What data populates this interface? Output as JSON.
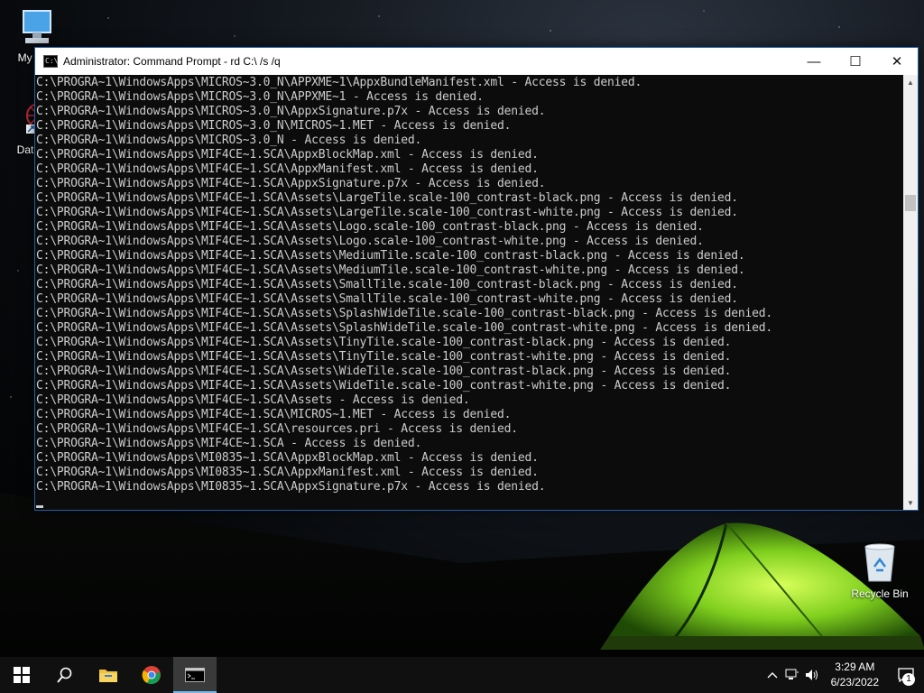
{
  "desktop": {
    "icons": [
      {
        "label": "My Co"
      },
      {
        "label": "DataW"
      },
      {
        "label": "Recycle Bin"
      }
    ]
  },
  "window": {
    "title": "Administrator: Command Prompt - rd  C:\\ /s /q",
    "controls": {
      "minimize": "—",
      "maximize": "☐",
      "close": "✕"
    },
    "lines": [
      "C:\\PROGRA~1\\WindowsApps\\MICROS~3.0_N\\APPXME~1\\AppxBundleManifest.xml - Access is denied.",
      "C:\\PROGRA~1\\WindowsApps\\MICROS~3.0_N\\APPXME~1 - Access is denied.",
      "C:\\PROGRA~1\\WindowsApps\\MICROS~3.0_N\\AppxSignature.p7x - Access is denied.",
      "C:\\PROGRA~1\\WindowsApps\\MICROS~3.0_N\\MICROS~1.MET - Access is denied.",
      "C:\\PROGRA~1\\WindowsApps\\MICROS~3.0_N - Access is denied.",
      "C:\\PROGRA~1\\WindowsApps\\MIF4CE~1.SCA\\AppxBlockMap.xml - Access is denied.",
      "C:\\PROGRA~1\\WindowsApps\\MIF4CE~1.SCA\\AppxManifest.xml - Access is denied.",
      "C:\\PROGRA~1\\WindowsApps\\MIF4CE~1.SCA\\AppxSignature.p7x - Access is denied.",
      "C:\\PROGRA~1\\WindowsApps\\MIF4CE~1.SCA\\Assets\\LargeTile.scale-100_contrast-black.png - Access is denied.",
      "C:\\PROGRA~1\\WindowsApps\\MIF4CE~1.SCA\\Assets\\LargeTile.scale-100_contrast-white.png - Access is denied.",
      "C:\\PROGRA~1\\WindowsApps\\MIF4CE~1.SCA\\Assets\\Logo.scale-100_contrast-black.png - Access is denied.",
      "C:\\PROGRA~1\\WindowsApps\\MIF4CE~1.SCA\\Assets\\Logo.scale-100_contrast-white.png - Access is denied.",
      "C:\\PROGRA~1\\WindowsApps\\MIF4CE~1.SCA\\Assets\\MediumTile.scale-100_contrast-black.png - Access is denied.",
      "C:\\PROGRA~1\\WindowsApps\\MIF4CE~1.SCA\\Assets\\MediumTile.scale-100_contrast-white.png - Access is denied.",
      "C:\\PROGRA~1\\WindowsApps\\MIF4CE~1.SCA\\Assets\\SmallTile.scale-100_contrast-black.png - Access is denied.",
      "C:\\PROGRA~1\\WindowsApps\\MIF4CE~1.SCA\\Assets\\SmallTile.scale-100_contrast-white.png - Access is denied.",
      "C:\\PROGRA~1\\WindowsApps\\MIF4CE~1.SCA\\Assets\\SplashWideTile.scale-100_contrast-black.png - Access is denied.",
      "C:\\PROGRA~1\\WindowsApps\\MIF4CE~1.SCA\\Assets\\SplashWideTile.scale-100_contrast-white.png - Access is denied.",
      "C:\\PROGRA~1\\WindowsApps\\MIF4CE~1.SCA\\Assets\\TinyTile.scale-100_contrast-black.png - Access is denied.",
      "C:\\PROGRA~1\\WindowsApps\\MIF4CE~1.SCA\\Assets\\TinyTile.scale-100_contrast-white.png - Access is denied.",
      "C:\\PROGRA~1\\WindowsApps\\MIF4CE~1.SCA\\Assets\\WideTile.scale-100_contrast-black.png - Access is denied.",
      "C:\\PROGRA~1\\WindowsApps\\MIF4CE~1.SCA\\Assets\\WideTile.scale-100_contrast-white.png - Access is denied.",
      "C:\\PROGRA~1\\WindowsApps\\MIF4CE~1.SCA\\Assets - Access is denied.",
      "C:\\PROGRA~1\\WindowsApps\\MIF4CE~1.SCA\\MICROS~1.MET - Access is denied.",
      "C:\\PROGRA~1\\WindowsApps\\MIF4CE~1.SCA\\resources.pri - Access is denied.",
      "C:\\PROGRA~1\\WindowsApps\\MIF4CE~1.SCA - Access is denied.",
      "C:\\PROGRA~1\\WindowsApps\\MI0835~1.SCA\\AppxBlockMap.xml - Access is denied.",
      "C:\\PROGRA~1\\WindowsApps\\MI0835~1.SCA\\AppxManifest.xml - Access is denied.",
      "C:\\PROGRA~1\\WindowsApps\\MI0835~1.SCA\\AppxSignature.p7x - Access is denied."
    ],
    "scroll_position": 0.27
  },
  "taskbar": {
    "apps": [
      {
        "icon": "windows-start-icon"
      },
      {
        "icon": "search-icon"
      },
      {
        "icon": "file-explorer-icon"
      },
      {
        "icon": "chrome-icon"
      },
      {
        "icon": "command-prompt-icon",
        "active": true
      }
    ],
    "clock": {
      "time": "3:29 AM",
      "date": "6/23/2022"
    },
    "notification_count": "1",
    "tray_icons": [
      "chevron-up-icon",
      "network-icon",
      "volume-icon"
    ]
  },
  "colors": {
    "console_bg": "#0c0c0c",
    "console_fg": "#cccccc",
    "taskbar_bg": "#101010",
    "accent": "#76b9ed"
  }
}
